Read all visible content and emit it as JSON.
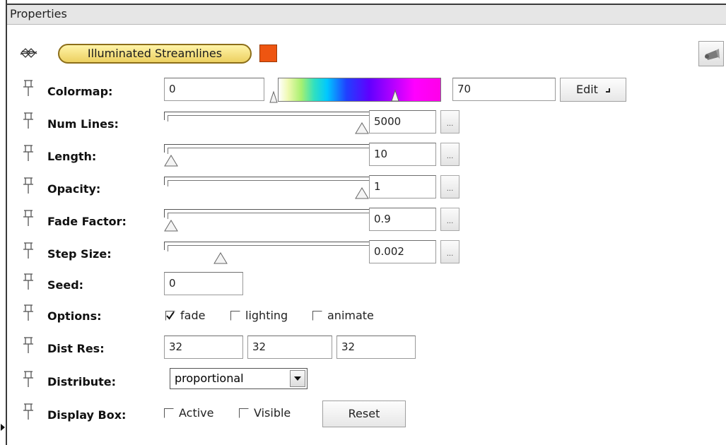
{
  "panel": {
    "title": "Properties"
  },
  "module": {
    "name": "Illuminated Streamlines",
    "swatch_color": "#ee5511"
  },
  "labels": {
    "colormap": "Colormap:",
    "num_lines": "Num Lines:",
    "length": "Length:",
    "opacity": "Opacity:",
    "fade_factor": "Fade Factor:",
    "step_size": "Step Size:",
    "seed": "Seed:",
    "options": "Options:",
    "dist_res": "Dist Res:",
    "distribute": "Distribute:",
    "display_box": "Display Box:"
  },
  "colormap": {
    "min": "0",
    "max": "70",
    "edit_label": "Edit",
    "min_marker": 0.0,
    "max_marker": 0.72
  },
  "sliders": {
    "num_lines": {
      "value": "5000",
      "level": 1.0
    },
    "length": {
      "value": "10",
      "level": 0.0
    },
    "opacity": {
      "value": "1",
      "level": 1.0
    },
    "fade_factor": {
      "value": "0.9",
      "level": 0.0
    },
    "step_size": {
      "value": "0.002",
      "level": 0.26
    }
  },
  "dots_label": "...",
  "seed": {
    "value": "0"
  },
  "options": {
    "fade": {
      "label": "fade",
      "checked": true
    },
    "lighting": {
      "label": "lighting",
      "checked": false
    },
    "animate": {
      "label": "animate",
      "checked": false
    }
  },
  "dist_res": {
    "x": "32",
    "y": "32",
    "z": "32"
  },
  "distribute": {
    "selected": "proportional"
  },
  "display_box": {
    "active": {
      "label": "Active",
      "checked": false
    },
    "visible": {
      "label": "Visible",
      "checked": false
    },
    "reset_label": "Reset"
  }
}
